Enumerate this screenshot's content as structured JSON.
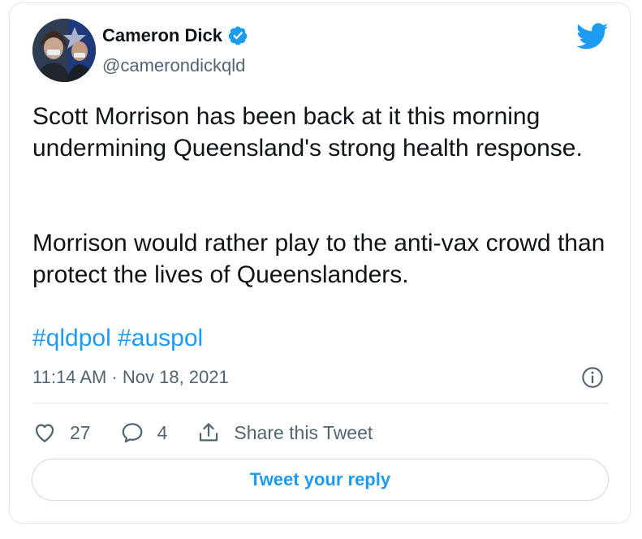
{
  "author": {
    "name": "Cameron Dick",
    "handle": "@camerondickqld",
    "avatar_icon": "profile-photo",
    "verified_icon": "verified-badge-icon"
  },
  "tweet": {
    "paragraph1": "Scott Morrison has been back at it this morning undermining Queensland's strong health response.",
    "paragraph2": "Morrison would rather play to the anti-vax crowd than protect the lives of Queenslanders.",
    "hashtags": [
      "#qldpol",
      "#auspol"
    ],
    "timestamp": "11:14 AM · Nov 18, 2021"
  },
  "actions": {
    "like_count": "27",
    "reply_count": "4",
    "share_label": "Share this Tweet"
  },
  "reply_button": "Tweet your reply",
  "colors": {
    "accent": "#1d9bf0",
    "text": "#0f1419",
    "muted": "#536471",
    "border": "#e1e6ea"
  }
}
